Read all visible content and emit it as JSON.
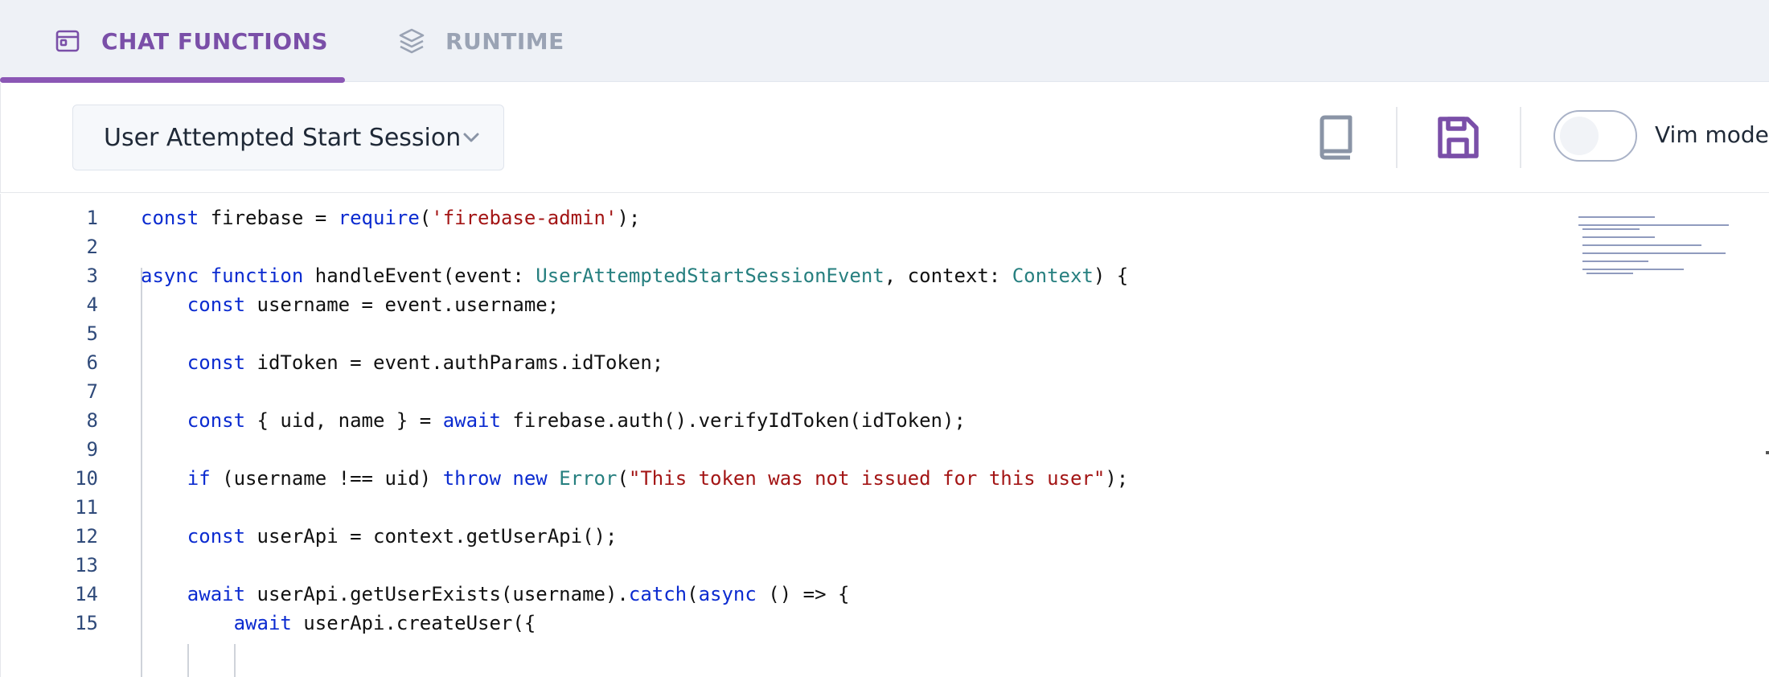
{
  "tabs": [
    {
      "label": "CHAT FUNCTIONS",
      "icon": "window-icon",
      "active": true
    },
    {
      "label": "RUNTIME",
      "icon": "layers-icon",
      "active": false
    }
  ],
  "toolbar": {
    "function_select": "User Attempted Start Session",
    "book_icon": "book-icon",
    "save_icon": "save-icon",
    "vim_toggle_on": false,
    "vim_label": "Vim mode"
  },
  "colors": {
    "accent": "#8b57b5",
    "keyword": "#0b2bd0",
    "string": "#a31515",
    "type": "#267f7f"
  },
  "editor": {
    "lines": [
      {
        "n": "1",
        "tokens": [
          [
            "kw",
            "const"
          ],
          [
            "t",
            " firebase = "
          ],
          [
            "kw",
            "require"
          ],
          [
            "t",
            "("
          ],
          [
            "str",
            "'firebase-admin'"
          ],
          [
            "t",
            ");"
          ]
        ]
      },
      {
        "n": "2",
        "tokens": []
      },
      {
        "n": "3",
        "tokens": [
          [
            "kw",
            "async function"
          ],
          [
            "t",
            " handleEvent(event: "
          ],
          [
            "type",
            "UserAttemptedStartSessionEvent"
          ],
          [
            "t",
            ", context: "
          ],
          [
            "type",
            "Context"
          ],
          [
            "t",
            ") {"
          ]
        ]
      },
      {
        "n": "4",
        "tokens": [
          [
            "t",
            "    "
          ],
          [
            "kw",
            "const"
          ],
          [
            "t",
            " username = event.username;"
          ]
        ]
      },
      {
        "n": "5",
        "tokens": []
      },
      {
        "n": "6",
        "tokens": [
          [
            "t",
            "    "
          ],
          [
            "kw",
            "const"
          ],
          [
            "t",
            " idToken = event.authParams.idToken;"
          ]
        ]
      },
      {
        "n": "7",
        "tokens": []
      },
      {
        "n": "8",
        "tokens": [
          [
            "t",
            "    "
          ],
          [
            "kw",
            "const"
          ],
          [
            "t",
            " { uid, name } = "
          ],
          [
            "kw",
            "await"
          ],
          [
            "t",
            " firebase.auth().verifyIdToken(idToken);"
          ]
        ]
      },
      {
        "n": "9",
        "tokens": []
      },
      {
        "n": "10",
        "tokens": [
          [
            "t",
            "    "
          ],
          [
            "kw",
            "if"
          ],
          [
            "t",
            " (username !== uid) "
          ],
          [
            "kw",
            "throw new"
          ],
          [
            "t",
            " "
          ],
          [
            "type",
            "Error"
          ],
          [
            "t",
            "("
          ],
          [
            "str",
            "\"This token was not issued for this user\""
          ],
          [
            "t",
            ");"
          ]
        ]
      },
      {
        "n": "11",
        "tokens": []
      },
      {
        "n": "12",
        "tokens": [
          [
            "t",
            "    "
          ],
          [
            "kw",
            "const"
          ],
          [
            "t",
            " userApi = context.getUserApi();"
          ]
        ]
      },
      {
        "n": "13",
        "tokens": []
      },
      {
        "n": "14",
        "tokens": [
          [
            "t",
            "    "
          ],
          [
            "kw",
            "await"
          ],
          [
            "t",
            " userApi.getUserExists(username)."
          ],
          [
            "kw",
            "catch"
          ],
          [
            "t",
            "("
          ],
          [
            "kw",
            "async"
          ],
          [
            "t",
            " () => {"
          ]
        ]
      },
      {
        "n": "15",
        "tokens": [
          [
            "t",
            "        "
          ],
          [
            "kw",
            "await"
          ],
          [
            "t",
            " userApi.createUser({"
          ]
        ]
      }
    ]
  }
}
